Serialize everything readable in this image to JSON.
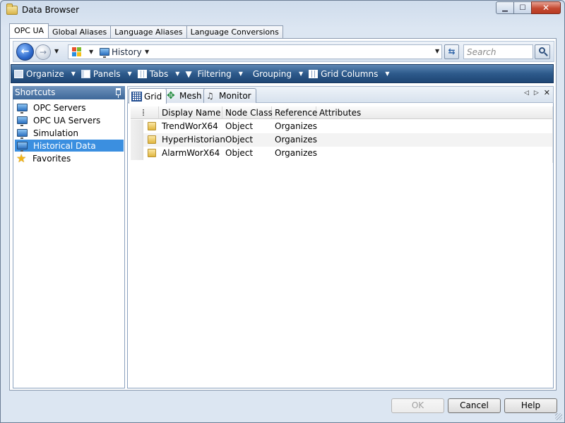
{
  "window": {
    "title": "Data Browser"
  },
  "tabs": [
    {
      "label": "OPC UA"
    },
    {
      "label": "Global Aliases"
    },
    {
      "label": "Language Aliases"
    },
    {
      "label": "Language Conversions"
    }
  ],
  "address": {
    "crumb": "History",
    "search_placeholder": "Search"
  },
  "toolbar": {
    "items": [
      {
        "label": "Organize",
        "icon": "organize-icon"
      },
      {
        "label": "Panels",
        "icon": "panels-icon"
      },
      {
        "label": "Tabs",
        "icon": "tabs-icon"
      },
      {
        "label": "Filtering",
        "icon": "filter-icon"
      },
      {
        "label": "Grouping",
        "icon": ""
      },
      {
        "label": "Grid Columns",
        "icon": "grid-columns-icon"
      }
    ]
  },
  "sidebar": {
    "header": "Shortcuts",
    "items": [
      {
        "label": "OPC Servers",
        "icon": "monitor-icon"
      },
      {
        "label": "OPC UA Servers",
        "icon": "monitor-icon"
      },
      {
        "label": "Simulation",
        "icon": "monitor-icon"
      },
      {
        "label": "Historical Data",
        "icon": "monitor-icon",
        "selected": true
      },
      {
        "label": "Favorites",
        "icon": "star-icon"
      }
    ]
  },
  "doc_tabs": [
    {
      "label": "Grid",
      "icon": "grid-icon",
      "active": true
    },
    {
      "label": "Mesh",
      "icon": "mesh-icon"
    },
    {
      "label": "Monitor",
      "icon": "monitor-binoculars-icon"
    }
  ],
  "grid": {
    "columns": [
      "Display Name",
      "Node Class",
      "Reference",
      "Attributes"
    ],
    "rows": [
      {
        "name": "TrendWorX64",
        "node_class": "Object",
        "reference": "Organizes",
        "attributes": ""
      },
      {
        "name": "HyperHistorian",
        "node_class": "Object",
        "reference": "Organizes",
        "attributes": ""
      },
      {
        "name": "AlarmWorX64",
        "node_class": "Object",
        "reference": "Organizes",
        "attributes": ""
      }
    ]
  },
  "buttons": {
    "ok": "OK",
    "cancel": "Cancel",
    "help": "Help"
  },
  "colors": {
    "toolbar": "#2d5a8b",
    "selection": "#3b8fe0",
    "close_button": "#c44a32"
  }
}
